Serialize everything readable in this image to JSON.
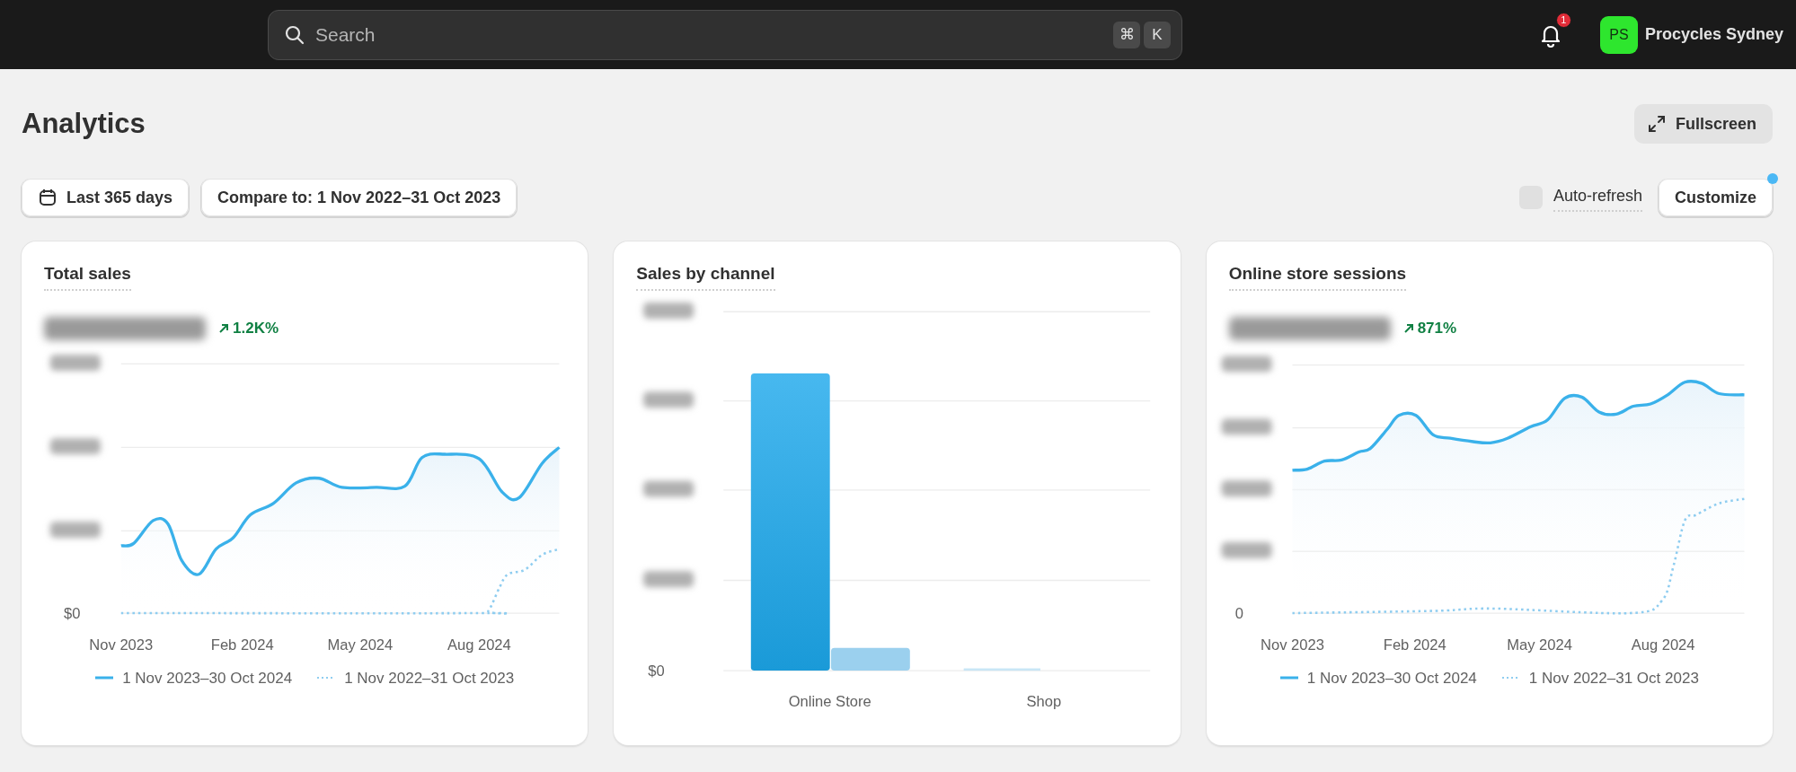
{
  "topbar": {
    "search": {
      "placeholder": "Search"
    },
    "shortcut_keys": [
      "⌘",
      "K"
    ],
    "notifications": {
      "count": "1"
    },
    "store": {
      "initials": "PS",
      "name": "Procycles Sydney"
    }
  },
  "page": {
    "title": "Analytics",
    "fullscreen_button": "Fullscreen"
  },
  "filters": {
    "date_range": "Last 365 days",
    "compare": "Compare to: 1 Nov 2022–31 Oct 2023",
    "auto_refresh": {
      "label": "Auto-refresh",
      "checked": false
    },
    "customize": {
      "label": "Customize",
      "has_update": true
    }
  },
  "cards": [
    {
      "kind": "line",
      "title": "Total sales",
      "change": "1.2K%",
      "y_zero": "$0",
      "x_labels": [
        "Nov 2023",
        "Feb 2024",
        "May 2024",
        "Aug 2024"
      ],
      "legend": [
        "1 Nov 2023–30 Oct 2024",
        "1 Nov 2022–31 Oct 2023"
      ]
    },
    {
      "kind": "bar",
      "title": "Sales by channel",
      "y_zero": "$0",
      "categories": [
        "Online Store",
        "Shop"
      ]
    },
    {
      "kind": "line",
      "title": "Online store sessions",
      "change": "871%",
      "y_zero": "0",
      "x_labels": [
        "Nov 2023",
        "Feb 2024",
        "May 2024",
        "Aug 2024"
      ],
      "legend": [
        "1 Nov 2023–30 Oct 2024",
        "1 Nov 2022–31 Oct 2023"
      ]
    }
  ]
}
